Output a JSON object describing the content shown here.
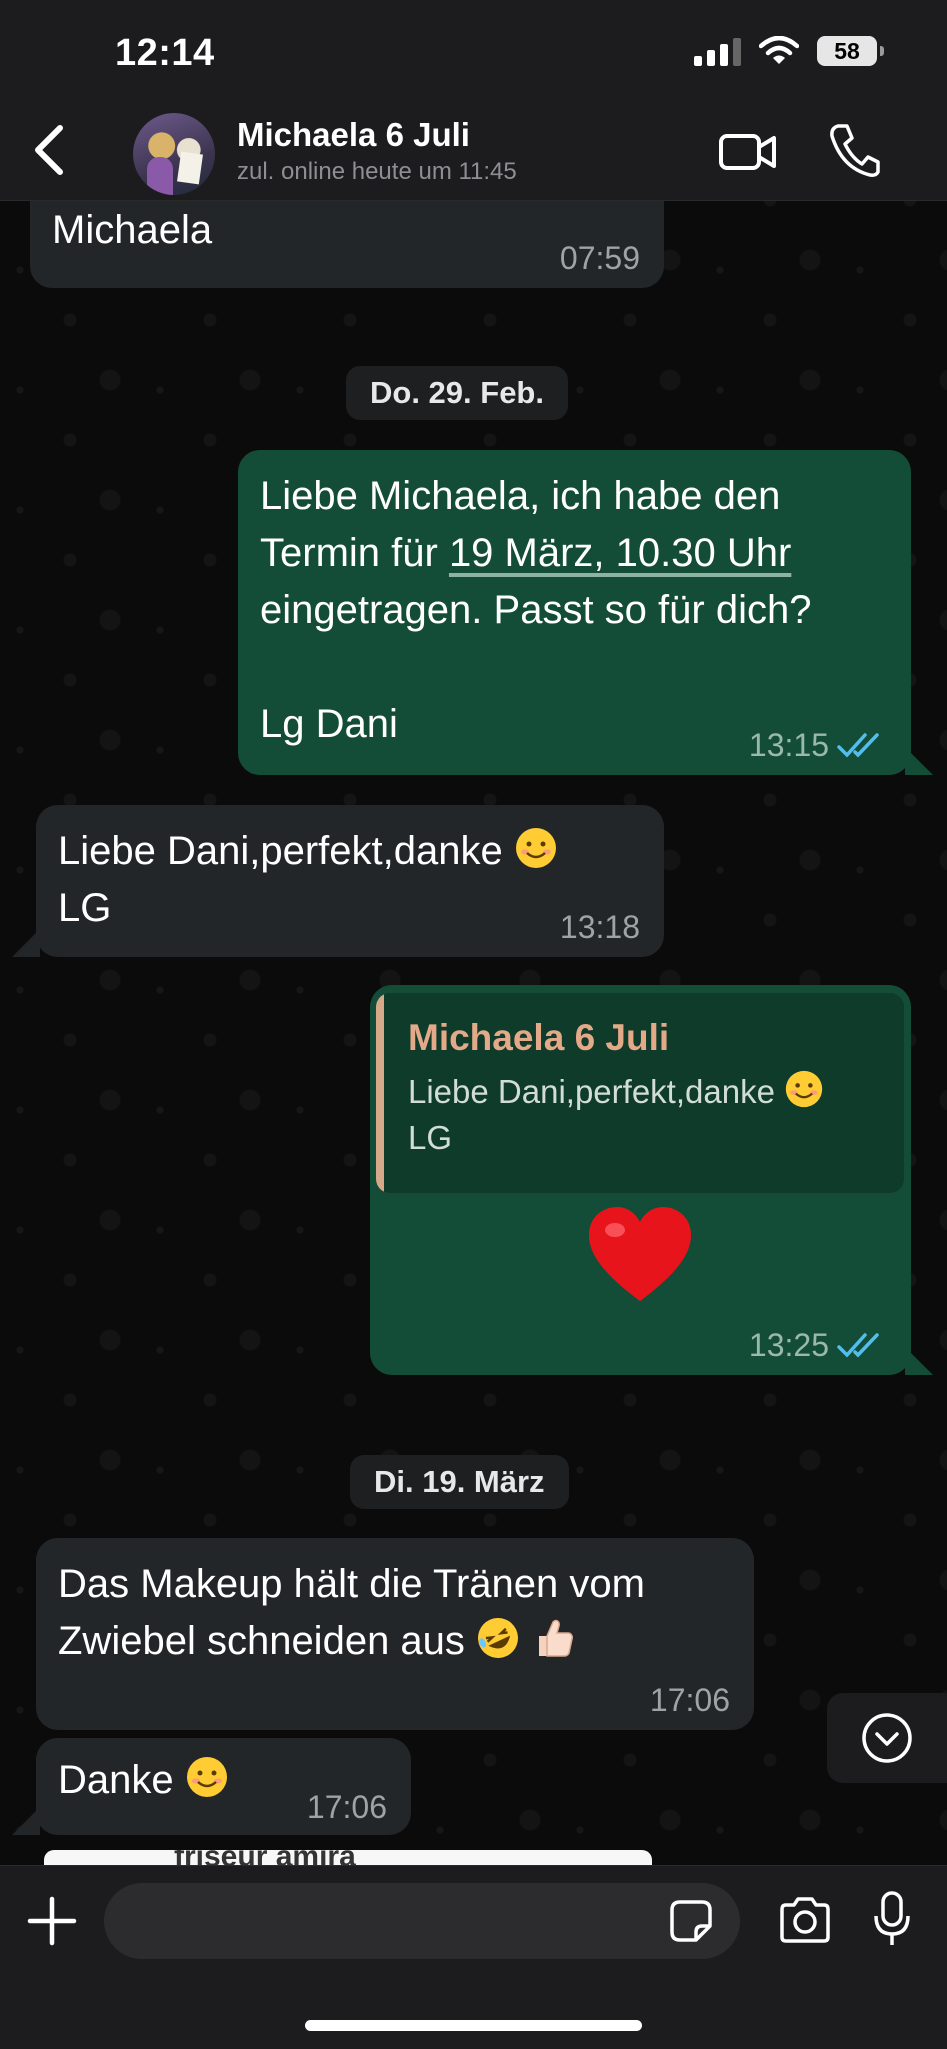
{
  "status_bar": {
    "time": "12:14",
    "battery": "58"
  },
  "header": {
    "contact_name": "Michaela 6 Juli",
    "contact_status": "zul. online heute um 11:45"
  },
  "messages": [
    {
      "direction": "in",
      "text": "Michaela",
      "time": "07:59"
    },
    {
      "type": "date",
      "text": "Do. 29. Feb."
    },
    {
      "direction": "out",
      "text_line1": "Liebe Michaela, ich habe den",
      "text_line2_pre": "Termin für ",
      "text_line2_link": "19 März, 10.30 Uhr",
      "text_line3": "eingetragen. Passt so für dich?",
      "text_line4": "Lg Dani",
      "time": "13:15",
      "status": "read"
    },
    {
      "direction": "in",
      "text_line1": "Liebe Dani,perfekt,danke",
      "text_line2": "LG",
      "time": "13:18"
    },
    {
      "direction": "out",
      "reply_to_name": "Michaela 6 Juli",
      "reply_to_text_line1": "Liebe Dani,perfekt,danke",
      "reply_to_text_line2": "LG",
      "body": "heart",
      "time": "13:25",
      "status": "read"
    },
    {
      "type": "date",
      "text": "Di. 19. März"
    },
    {
      "direction": "in",
      "text_line1": "Das Makeup hält die Tränen vom",
      "text_line2": "Zwiebel schneiden aus",
      "time": "17:06"
    },
    {
      "direction": "in",
      "text": "Danke",
      "time": "17:06"
    },
    {
      "direction": "in",
      "preview_text": "friseur amira"
    }
  ],
  "composer": {
    "placeholder": ""
  },
  "colors": {
    "outgoing": "#134d37",
    "incoming": "#232628",
    "read_ticks": "#53bdeb",
    "quote_accent": "#e3a988"
  },
  "icons": [
    "back-icon",
    "video-call-icon",
    "phone-icon",
    "plus-icon",
    "sticker-icon",
    "camera-icon",
    "microphone-icon",
    "scroll-down-icon",
    "read-ticks-icon"
  ]
}
